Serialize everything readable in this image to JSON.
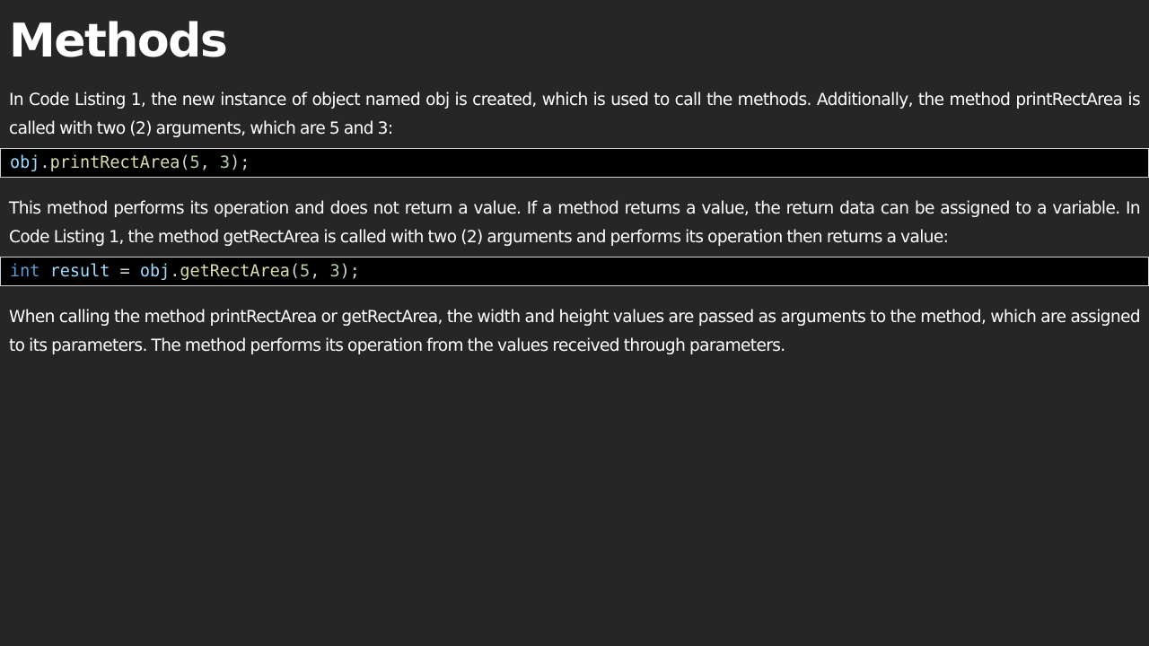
{
  "page": {
    "title": "Methods"
  },
  "paragraphs": [
    "In Code Listing 1, the new instance of object named obj is created, which is used to call the methods. Additionally, the method printRectArea is called with two (2) arguments, which are 5 and 3:",
    "This method performs its operation and does not return a value. If a method returns a value, the return data can be assigned to a variable. In Code Listing 1, the method getRectArea is called with two (2) arguments and performs its operation then returns a value:",
    "When calling the method printRectArea or getRectArea, the width and height values are passed as arguments to the method, which are assigned to its parameters. The method performs its operation from the values received through parameters."
  ],
  "code_blocks": [
    {
      "tokens": {
        "obj": "obj",
        "dot": ".",
        "method": "printRectArea",
        "open": "(",
        "arg1": "5",
        "comma": ", ",
        "arg2": "3",
        "close": ");"
      }
    },
    {
      "tokens": {
        "type": "int",
        "space1": " ",
        "var": "result",
        "assign": " = ",
        "obj": "obj",
        "dot": ".",
        "method": "getRectArea",
        "open": "(",
        "arg1": "5",
        "comma": ", ",
        "arg2": "3",
        "close": ");"
      }
    }
  ],
  "colors": {
    "background": "#262626",
    "text": "#ffffff",
    "code_background": "#000000",
    "code_border": "#cfcfcf",
    "syntax_variable": "#9cdcfe",
    "syntax_function": "#dcdcaa",
    "syntax_number": "#b5cea8",
    "syntax_keyword": "#569cd6",
    "syntax_punctuation": "#d4d4d4"
  }
}
